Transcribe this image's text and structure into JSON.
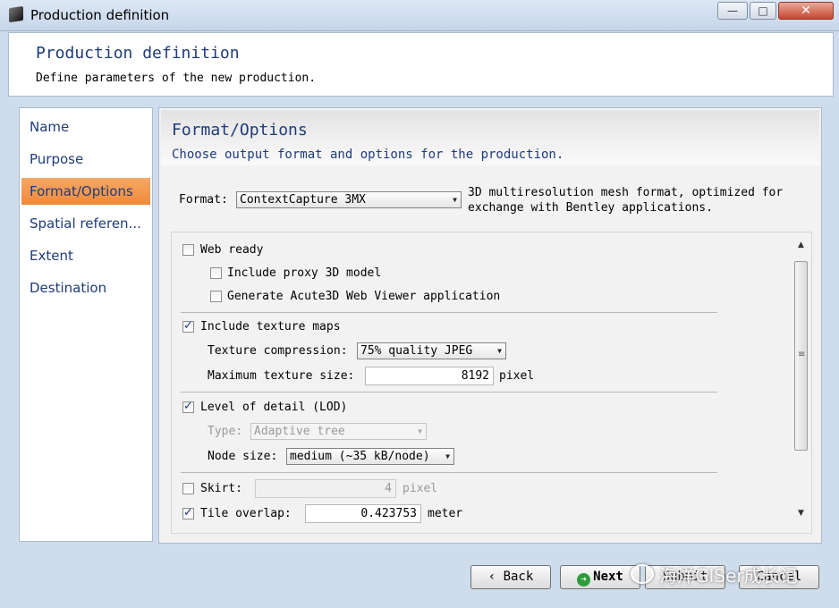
{
  "window": {
    "title": "Production definition",
    "controls": {
      "minimize": "—",
      "maximize": "□",
      "close": "✕"
    }
  },
  "header": {
    "title": "Production definition",
    "subtitle": "Define parameters of the new production."
  },
  "sidebar": {
    "items": [
      {
        "label": "Name"
      },
      {
        "label": "Purpose"
      },
      {
        "label": "Format/Options",
        "active": true
      },
      {
        "label": "Spatial referen..."
      },
      {
        "label": "Extent"
      },
      {
        "label": "Destination"
      }
    ],
    "active_color": "#ef8a3a"
  },
  "main": {
    "title": "Format/Options",
    "subtitle": "Choose output format and options for the production.",
    "format": {
      "label": "Format:",
      "value": "ContextCapture 3MX",
      "description_line1": "3D multiresolution mesh format, optimized for",
      "description_line2": "exchange with Bentley applications."
    },
    "options": {
      "web_ready": {
        "label": "Web ready",
        "checked": false
      },
      "proxy_model": {
        "label": "Include proxy 3D model",
        "checked": false
      },
      "web_viewer": {
        "label": "Generate Acute3D Web Viewer application",
        "checked": false
      },
      "texture_maps": {
        "label": "Include texture maps",
        "checked": true
      },
      "texture_compression": {
        "label": "Texture compression:",
        "value": "75% quality JPEG"
      },
      "max_texture_size": {
        "label": "Maximum texture size:",
        "value": "8192",
        "unit": "pixel"
      },
      "lod": {
        "label": "Level of detail (LOD)",
        "checked": true
      },
      "lod_type": {
        "label": "Type:",
        "value": "Adaptive tree"
      },
      "node_size": {
        "label": "Node size:",
        "value": "medium (~35 kB/node)"
      },
      "skirt": {
        "label": "Skirt:",
        "checked": false,
        "value": "4",
        "unit": "pixel"
      },
      "tile_overlap": {
        "label": "Tile overlap:",
        "checked": true,
        "value": "0.423753",
        "unit": "meter"
      }
    }
  },
  "buttons": {
    "back": "Back",
    "next": "Next",
    "submit": "Submit",
    "cancel": "Cancel"
  },
  "icons": {
    "back": "chevron-left-icon",
    "next": "green-arrow-circle-icon",
    "check": "checkmark-icon"
  },
  "watermark": "海洋GISer成长记"
}
